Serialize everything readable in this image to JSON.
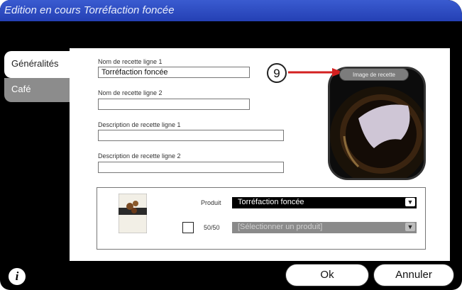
{
  "window": {
    "title": "Edition en cours Torréfaction foncée"
  },
  "tabs": [
    {
      "label": "Généralités",
      "active": true
    },
    {
      "label": "Café",
      "active": false
    }
  ],
  "form": {
    "name1": {
      "label": "Nom de recette ligne 1",
      "value": "Torréfaction foncée"
    },
    "name2": {
      "label": "Nom de recette ligne 2",
      "value": ""
    },
    "desc1": {
      "label": "Description de recette ligne 1",
      "value": ""
    },
    "desc2": {
      "label": "Description de recette ligne 2",
      "value": ""
    }
  },
  "image": {
    "button_label": "Image de recette",
    "callout": "9"
  },
  "product": {
    "label": "Produit",
    "value": "Torréfaction foncée",
    "mix_label": "50/50",
    "mix_checked": false,
    "mix_placeholder": "[Sélectionner un produit]"
  },
  "footer": {
    "info": "i",
    "ok_label": "Ok",
    "cancel_label": "Annuler"
  },
  "colors": {
    "title_bar": "#2f4ec4",
    "accent_arrow": "#d32020",
    "dropdown_active": "#000000",
    "dropdown_disabled": "#8a8a8a"
  }
}
